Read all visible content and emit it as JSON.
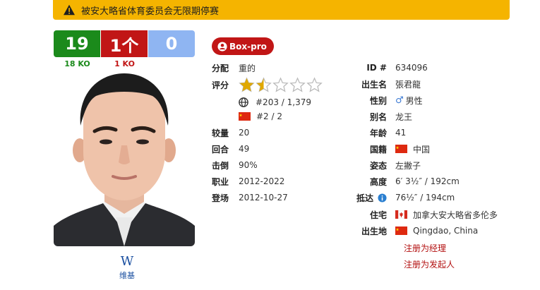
{
  "banner": {
    "text": "被安大略省体育委员会无限期停赛",
    "icon": "warning-icon",
    "color": "#f5b400"
  },
  "record": {
    "wins": "19",
    "losses": "1个",
    "draws": "0",
    "wins_ko": "18 KO",
    "losses_ko": "1 KO"
  },
  "wiki": {
    "icon": "W",
    "label": "维基"
  },
  "badge": "Box-pro",
  "left": {
    "division_label": "分配",
    "division": "重的",
    "rating_label": "评分",
    "rating_stars": 1.5,
    "rating_max": 5,
    "world_rank": "#203 / 1,379",
    "country_rank": "#2 / 2",
    "bouts_label": "较量",
    "bouts": "20",
    "rounds_label": "回合",
    "rounds": "49",
    "ko_label": "击倒",
    "ko": "90%",
    "career_label": "职业",
    "career": "2012-2022",
    "debut_label": "登场",
    "debut": "2012-10-27"
  },
  "right": {
    "id_label": "ID #",
    "id": "634096",
    "name_label": "出生名",
    "name": "張君龍",
    "sex_label": "性别",
    "sex": "男性",
    "alias_label": "别名",
    "alias": "龙王",
    "age_label": "年龄",
    "age": "41",
    "nationality_label": "国籍",
    "nationality": "中国",
    "stance_label": "姿态",
    "stance": "左撇子",
    "height_label": "高度",
    "height": "6′ 3½″ / 192cm",
    "reach_label": "抵达",
    "reach": "76½″ / 194cm",
    "residence_label": "住宅",
    "residence": "加拿大安大略省多伦多",
    "birthplace_label": "出生地",
    "birthplace": "Qingdao, China",
    "link_manager": "注册为经理",
    "link_promoter": "注册为发起人"
  },
  "colors": {
    "win": "#1b8a1b",
    "loss": "#c11616",
    "draw": "#8fb5f2",
    "star": "#e0a800",
    "link": "#b30f0f"
  }
}
